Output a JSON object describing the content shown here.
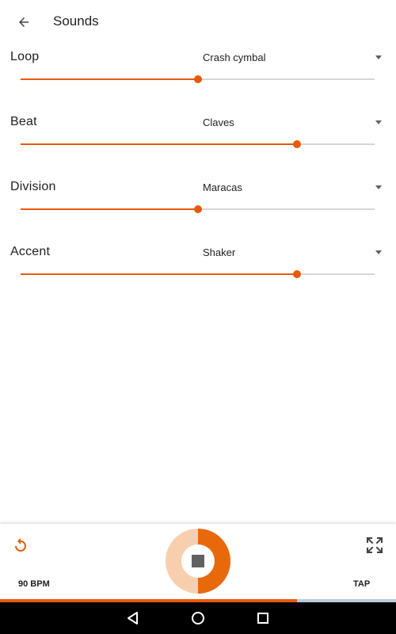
{
  "app": {
    "title": "Sounds"
  },
  "accent_color": "#e8590c",
  "rows": [
    {
      "label": "Loop",
      "sound": "Crash cymbal",
      "level": 0.5
    },
    {
      "label": "Beat",
      "sound": "Claves",
      "level": 0.78
    },
    {
      "label": "Division",
      "sound": "Maracas",
      "level": 0.5
    },
    {
      "label": "Accent",
      "sound": "Shaker",
      "level": 0.78
    }
  ],
  "bottom": {
    "bpm": "90 BPM",
    "tap_label": "TAP",
    "progress": 0.75,
    "playing": true
  },
  "icons": {
    "back": "back-arrow-icon",
    "reset": "refresh-icon",
    "expand": "fullscreen-icon",
    "stop": "stop-icon",
    "nav_back": "triangle-back-icon",
    "nav_home": "circle-home-icon",
    "nav_recents": "square-recents-icon"
  }
}
